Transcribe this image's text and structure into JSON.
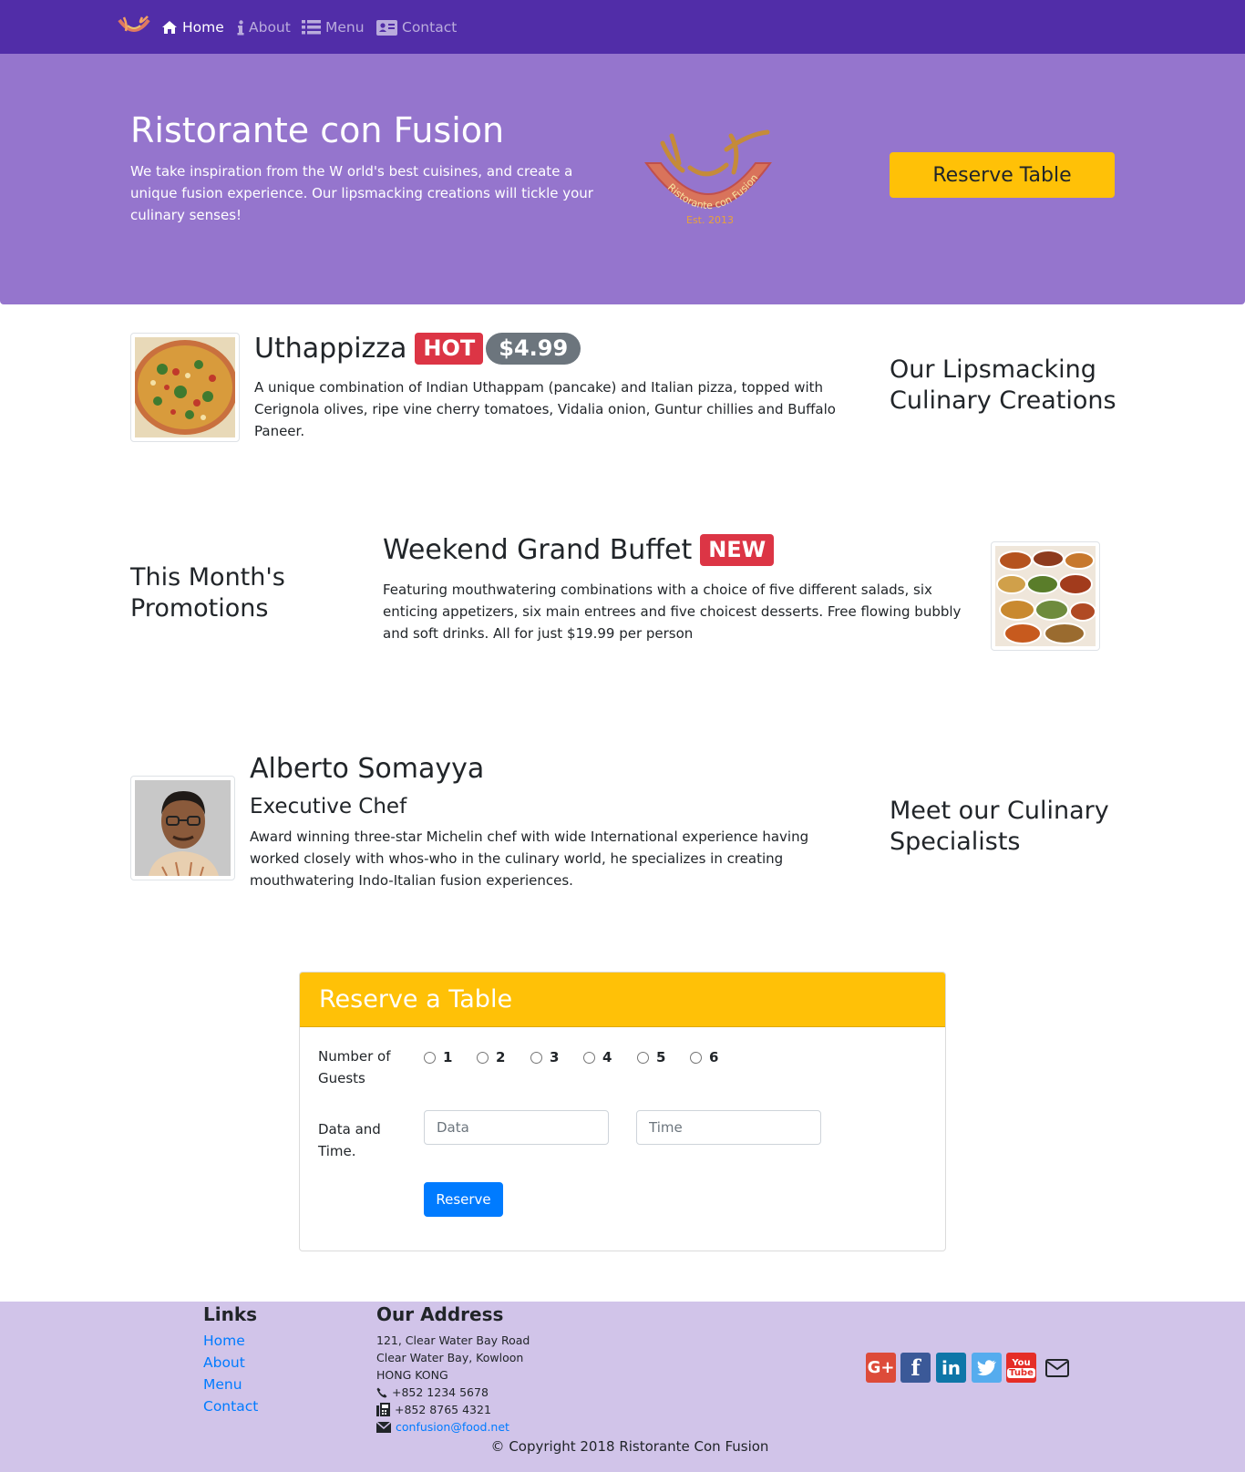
{
  "nav": {
    "items": [
      {
        "label": "Home",
        "icon": "home-icon",
        "active": true
      },
      {
        "label": "About",
        "icon": "info-icon"
      },
      {
        "label": "Menu",
        "icon": "list-icon"
      },
      {
        "label": "Contact",
        "icon": "address-card-icon"
      }
    ]
  },
  "jumbotron": {
    "title": "Ristorante con Fusion",
    "text": "We take inspiration from the W orld's best cuisines, and create a unique fusion experience. Our lipsmacking creations will tickle your culinary senses!",
    "logo_text": "Ristorante con Fusion",
    "logo_est": "Est. 2013",
    "reserve_label": "Reserve Table"
  },
  "dish": {
    "name": "Uthappizza",
    "badge": "HOT",
    "price": "$4.99",
    "description": "A unique combination of Indian Uthappam (pancake) and Italian pizza, topped with Cerignola olives, ripe vine cherry tomatoes, Vidalia onion, Guntur chillies and Buffalo Paneer.",
    "section_title": "Our Lipsmacking Culinary Creations"
  },
  "promotion": {
    "name": "Weekend Grand Buffet",
    "badge": "NEW",
    "description": "Featuring mouthwatering combinations with a choice of five different salads, six enticing appetizers, six main entrees and five choicest desserts. Free flowing bubbly and soft drinks. All for just $19.99 per person",
    "section_title": "This Month's Promotions"
  },
  "leader": {
    "name": "Alberto Somayya",
    "designation": "Executive Chef",
    "description": "Award winning three-star Michelin chef with wide International experience having worked closely with whos-who in the culinary world, he specializes in creating mouthwatering Indo-Italian fusion experiences.",
    "section_title": "Meet our Culinary Specialists"
  },
  "reservation": {
    "title": "Reserve a Table",
    "guests_label": "Number of Guests",
    "guest_options": [
      "1",
      "2",
      "3",
      "4",
      "5",
      "6"
    ],
    "datetime_label": "Data and Time.",
    "date_placeholder": "Data",
    "time_placeholder": "Time",
    "submit_label": "Reserve"
  },
  "footer": {
    "links_title": "Links",
    "links": [
      "Home",
      "About",
      "Menu",
      "Contact"
    ],
    "address_title": "Our Address",
    "address_lines": [
      "121, Clear Water Bay Road",
      "Clear Water Bay, Kowloon",
      "HONG KONG"
    ],
    "phone": "+852 1234 5678",
    "fax": "+852 8765 4321",
    "email": "confusion@food.net",
    "social": [
      {
        "icon": "google-plus-icon",
        "color": "#dd4b39"
      },
      {
        "icon": "facebook-icon",
        "color": "#3b5998"
      },
      {
        "icon": "linkedin-icon",
        "color": "#0e76a8"
      },
      {
        "icon": "twitter-icon",
        "color": "#55acee"
      },
      {
        "icon": "youtube-icon",
        "color": "#e52d27"
      },
      {
        "icon": "envelope-icon",
        "color": "#212529"
      }
    ],
    "copyright": "© Copyright 2018 Ristorante Con Fusion"
  },
  "colors": {
    "primary": "#512DA8",
    "jumbotron": "#9575CD",
    "footer": "#D1C4E9",
    "warning": "#FFC107",
    "danger": "#dc3545",
    "link": "#007bff"
  }
}
